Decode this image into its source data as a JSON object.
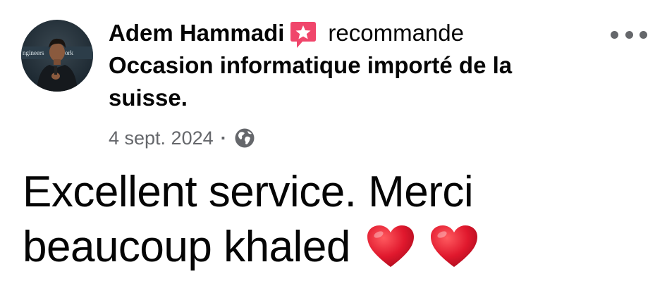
{
  "post": {
    "author_name": "Adem Hammadi",
    "action_text": "recommande",
    "page_name": "Occasion informatique importé de la suisse.",
    "date": "4 sept. 2024",
    "separator": "·",
    "privacy_icon": "globe-icon",
    "badge_icon": "recommendation-star-icon",
    "more_icon": "more-options-icon",
    "body_text": "Excellent service. Merci beaucoup khaled",
    "body_emoji": [
      "red-heart",
      "red-heart"
    ]
  },
  "colors": {
    "text_primary": "#050505",
    "text_secondary": "#65676b",
    "badge_pink": "#f0466b",
    "heart_red": "#e0182d"
  }
}
